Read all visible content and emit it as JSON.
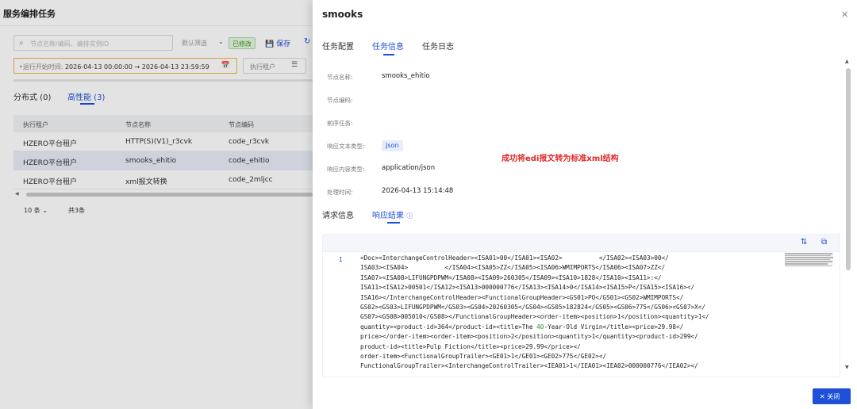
{
  "background": {
    "page_title": "服务编排任务",
    "search_placeholder": "节点名称/编码、编排实例ID",
    "filter_default": "默认筛选",
    "filter_caret": "⌄",
    "modified_tag": "已修改",
    "save_label": "保存",
    "save_icon": "💾",
    "reload_icon": "↻",
    "date_filter": {
      "label": "•运行开始时间:",
      "start": "2026-04-13 00:00:00",
      "arrow": "→",
      "end": "2026-04-13 23:59:59",
      "icon": "📅"
    },
    "tenant_filter": "执行租户",
    "tenant_filter_icon": "☰",
    "tabs": [
      {
        "label": "分布式 (0)"
      },
      {
        "label": "高性能 (3)"
      }
    ],
    "table": {
      "columns": [
        "执行租户",
        "节点名称",
        "节点编码"
      ],
      "rows": [
        {
          "tenant": "HZERO平台租户",
          "node_name": "HTTP(S)(V1)_r3cvk",
          "node_code": "code_r3cvk"
        },
        {
          "tenant": "HZERO平台租户",
          "node_name": "smooks_ehitio",
          "node_code": "code_ehitio"
        },
        {
          "tenant": "HZERO平台租户",
          "node_name": "xml报文转换",
          "node_code": "code_2mljcc"
        }
      ]
    },
    "pager": {
      "page_size": "10 条 ⌄",
      "total": "共3条"
    },
    "scroll_arrow": "◀"
  },
  "drawer": {
    "title": "smooks",
    "close_icon": "✕",
    "tabs": [
      {
        "label": "任务配置"
      },
      {
        "label": "任务信息"
      },
      {
        "label": "任务日志"
      }
    ],
    "fields": [
      {
        "label": "节点名称:",
        "value": "smooks_ehitio"
      },
      {
        "label": "节点编码:",
        "value": ""
      },
      {
        "label": "前序任务:",
        "value": ""
      },
      {
        "label": "响应文本类型:",
        "value": "Json"
      },
      {
        "label": "响应内容类型:",
        "value": "application/json"
      },
      {
        "label": "处理时间:",
        "value": "2026-04-13 15:14:48"
      }
    ],
    "annotation": "成功将edi报文转为标准xml结构",
    "sub_tabs": [
      {
        "label": "请求信息"
      },
      {
        "label": "响应结果",
        "help_icon": "ⓘ"
      }
    ],
    "code": {
      "line_number": "1",
      "copy_icon": "⧉",
      "format_icon": "⇅",
      "lines": [
        "<Doc><InterchangeControlHeader><ISA01>00</ISA01><ISA02>          </ISA02><ISA03>00</",
        "ISA03><ISA04>          </ISA04><ISA05>ZZ</ISA05><ISA06>WMIMPORTS</ISA06><ISA07>ZZ</",
        "ISA07><ISA08>LIFUNGPDPWM</ISA08><ISA09>260305</ISA09><ISA10>1828</ISA10><ISA11>:</",
        "ISA11><ISA12>00501</ISA12><ISA13>000000776</ISA13><ISA14>0</ISA14><ISA15>P</ISA15><ISA16></",
        "ISA16></InterchangeControlHeader><FunctionalGroupHeader><GS01>PO</GS01><GS02>WMIMPORTS</",
        "GS02><GS03>LIFUNGPDPWM</GS03><GS04>20260305</GS04><GS05>182824</GS05><GS06>775</GS06><GS07>X</",
        "GS07><GS08>005010</GS08></FunctionalGroupHeader><order-item><position>1</position><quantity>1</",
        "quantity><product-id>364</product-id><title>The 40-Year-Old Virgin</title><price>29.98</",
        "price></order-item><order-item><position>2</position><quantity>1</quantity><product-id>299</",
        "product-id><title>Pulp Fiction</title><price>29.99</price></",
        "order-item><FunctionalGroupTrailer><GE01>1</GE01><GE02>775</GE02></",
        "FunctionalGroupTrailer><InterchangeControlTrailer><IEA01>1</IEA01><IEA02>000000776</IEA02></"
      ]
    },
    "scroll": {
      "up": "▲",
      "down": "▼"
    },
    "close_button": {
      "icon": "✕",
      "label": "关闭"
    }
  }
}
